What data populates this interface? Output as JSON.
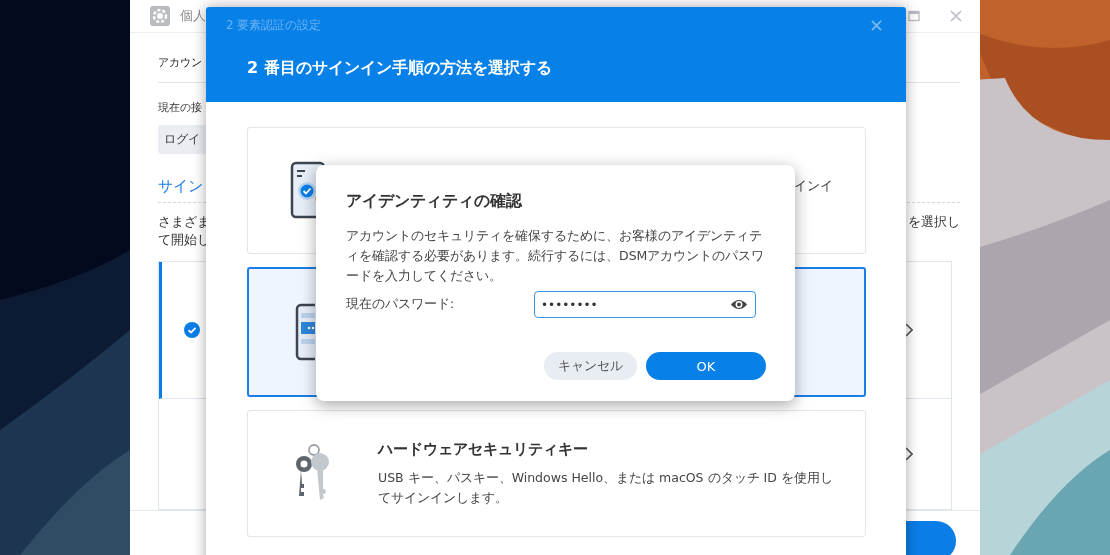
{
  "background_window": {
    "title": "個人",
    "section_heading": "アカウン",
    "current_label": "現在の接",
    "login_button": "ログイ",
    "signin_heading": "サイン",
    "description_left": [
      "さまざま",
      "て開始し"
    ],
    "description_right": "を選択し",
    "methods": [
      {
        "selected": true
      },
      {
        "selected": false
      }
    ]
  },
  "wizard": {
    "title": "2 要素認証の設定",
    "heading": "2 番目のサインイン手順の方法を選択する",
    "options": [
      {
        "kind": "approval",
        "selected": false,
        "description": "インイ"
      },
      {
        "kind": "otp",
        "selected": true
      },
      {
        "kind": "hardware-key",
        "selected": false,
        "title": "ハードウェアセキュリティキー",
        "description": "USB キー、パスキー、Windows Hello、または macOS のタッチ ID を使用してサインインします。"
      }
    ]
  },
  "confirm_dialog": {
    "title": "アイデンティティの確認",
    "message": "アカウントのセキュリティを確保するために、お客様のアイデンティティを確認する必要があります。続行するには、DSMアカウントのパスワードを入力してください。",
    "password": {
      "label": "現在のパスワード:",
      "value": "••••••••"
    },
    "buttons": [
      {
        "kind": "secondary",
        "label": "キャンセル"
      },
      {
        "kind": "primary",
        "label": "OK"
      }
    ]
  }
}
